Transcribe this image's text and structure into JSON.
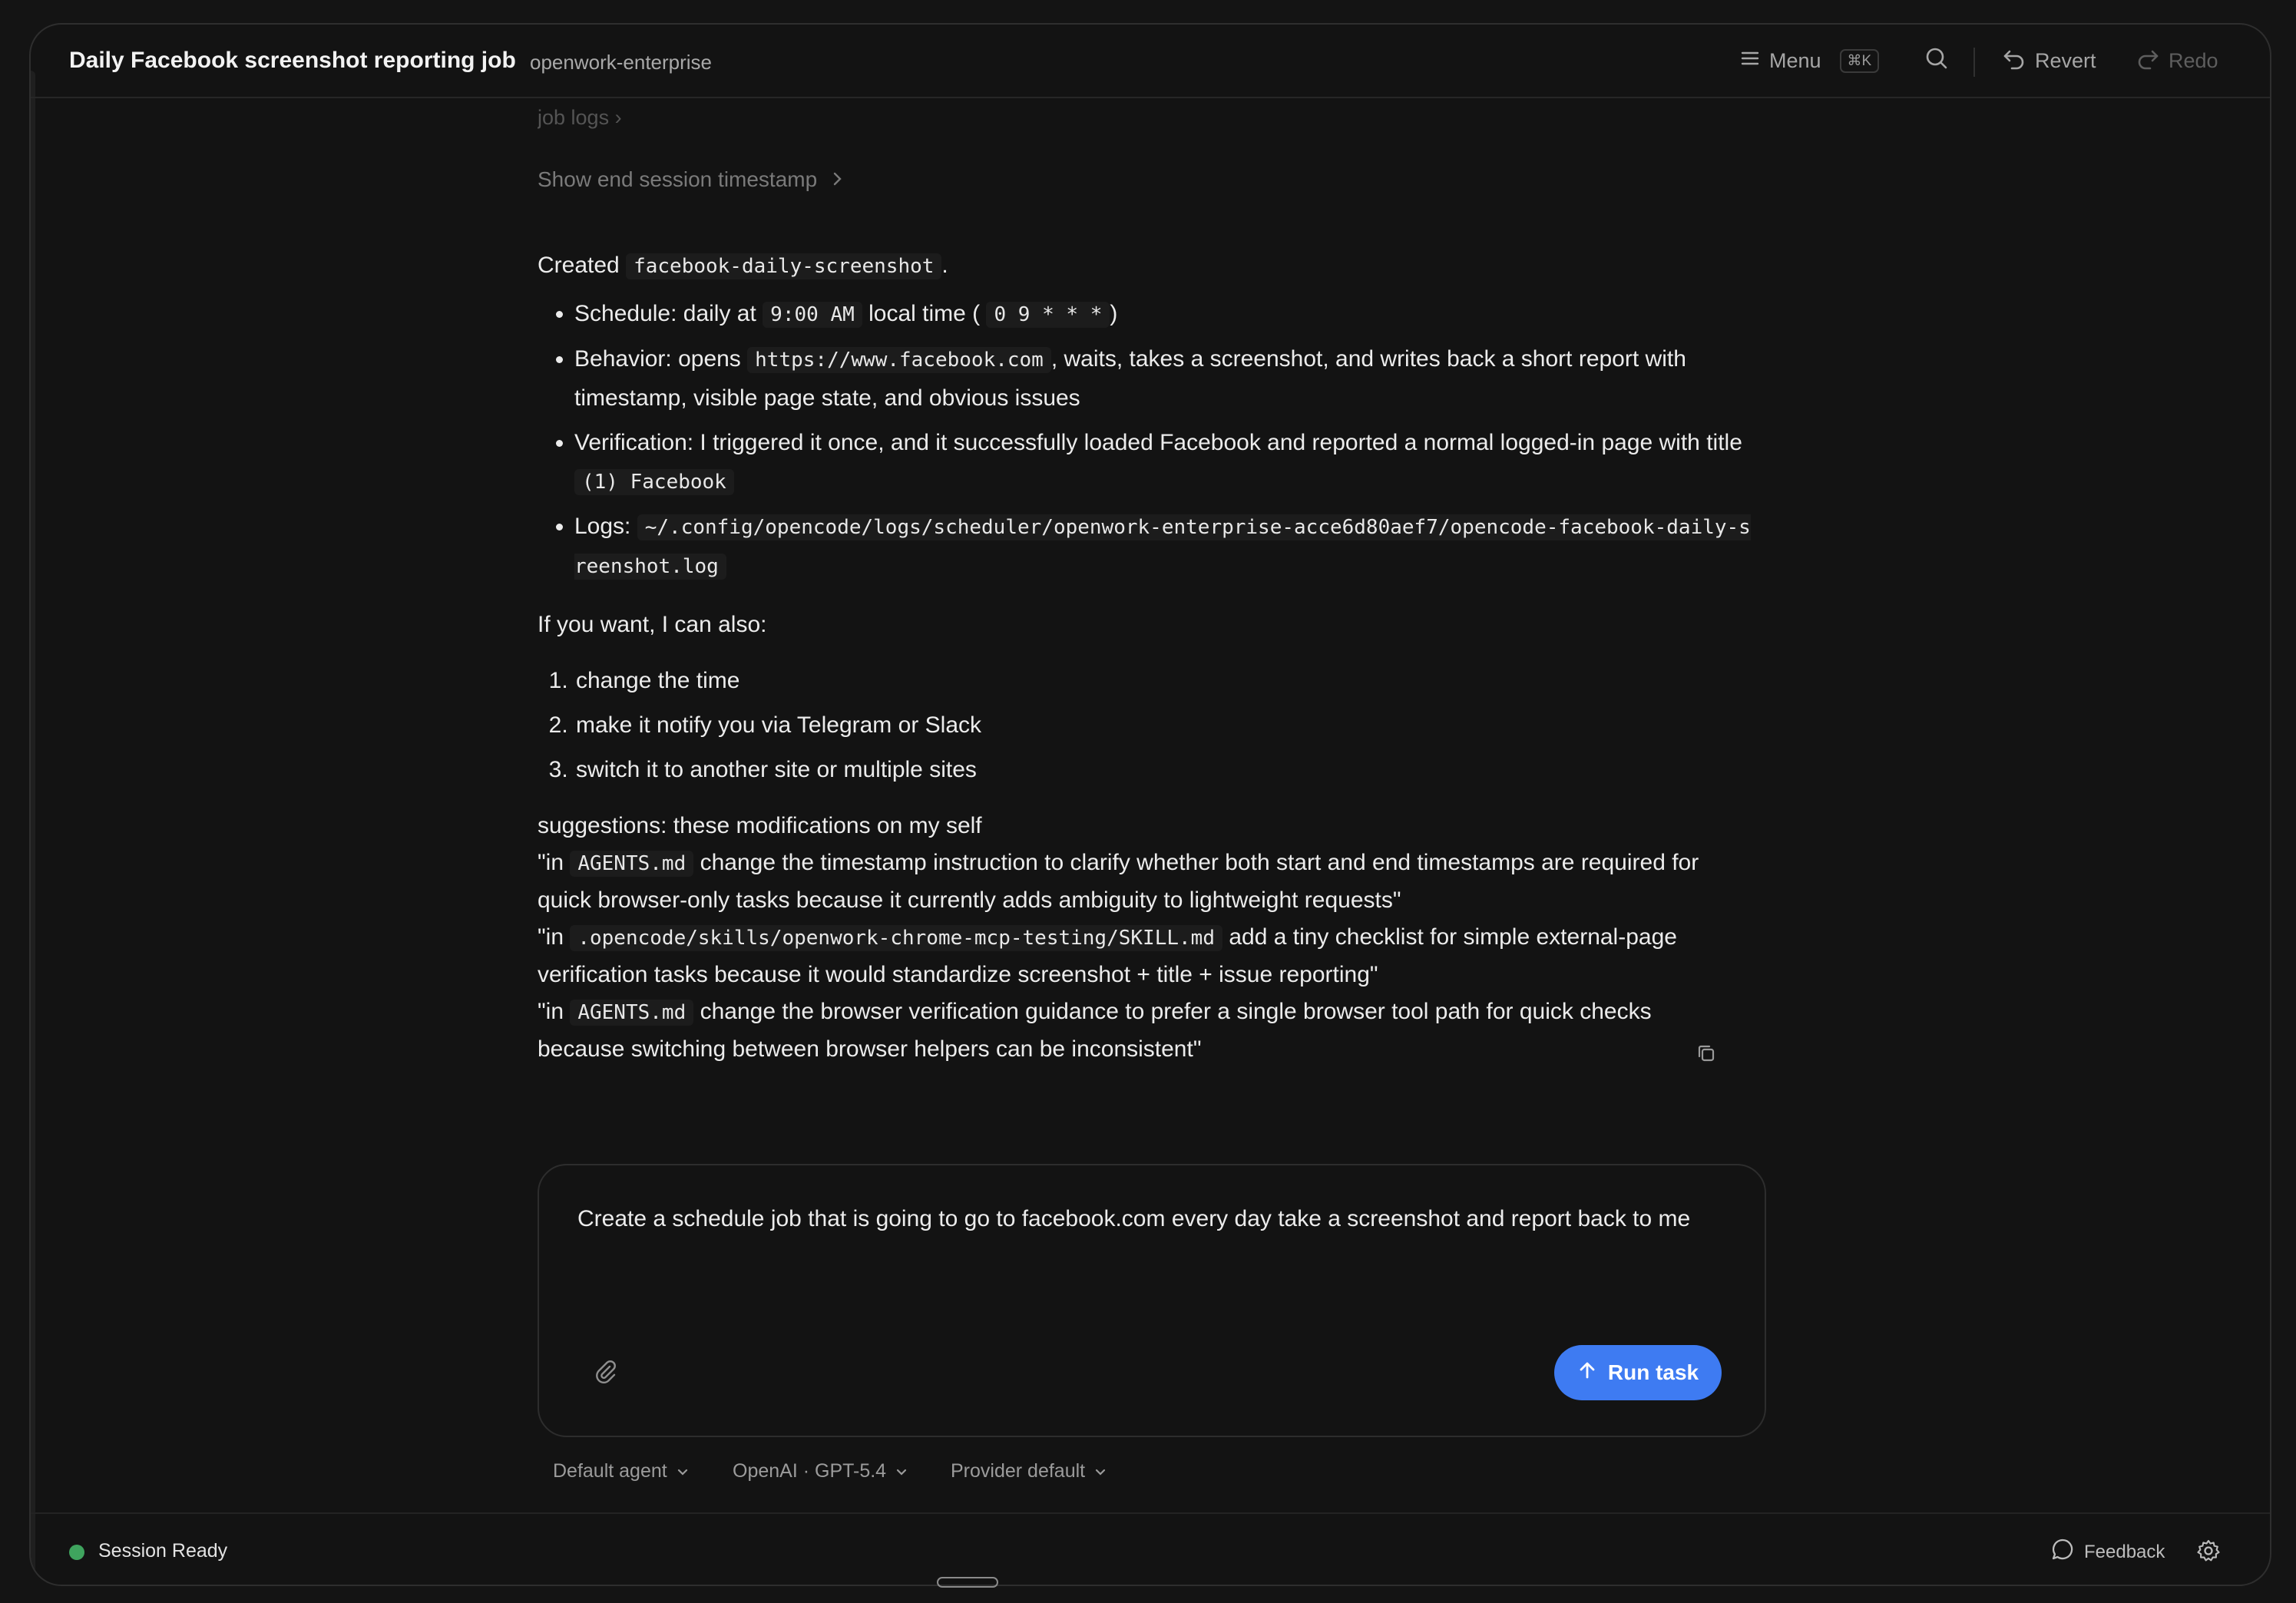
{
  "header": {
    "title": "Daily Facebook screenshot reporting job",
    "workspace": "openwork-enterprise",
    "menu_label": "Menu",
    "menu_shortcut": "⌘K",
    "revert_label": "Revert",
    "redo_label": "Redo"
  },
  "transcript": {
    "job_logs_label": "job logs",
    "show_end_session": "Show end session timestamp",
    "created_prefix": "Created",
    "created_job": "facebook-daily-screenshot",
    "created_suffix": ".",
    "bullets": {
      "schedule_label": "Schedule: daily at",
      "schedule_time": "9:00 AM",
      "schedule_mid": "local time (",
      "schedule_cron": "0 9 * * *",
      "schedule_end": ")",
      "behavior_label": "Behavior: opens",
      "behavior_url": "https://www.facebook.com",
      "behavior_rest": ", waits, takes a screenshot, and writes back a short report with timestamp, visible page state, and obvious issues",
      "verification_text": "Verification: I triggered it once, and it successfully loaded Facebook and reported a normal logged-in page with title",
      "verification_title": "(1) Facebook",
      "logs_label": "Logs:",
      "logs_path": "~/.config/opencode/logs/scheduler/openwork-enterprise-acce6d80aef7/opencode-facebook-daily-screenshot.log"
    },
    "offer": "If you want, I can also:",
    "options": [
      "change the time",
      "make it notify you via Telegram or Slack",
      "switch it to another site or multiple sites"
    ],
    "suggestions_heading": "suggestions: these modifications on my self",
    "s1_pre": "\"in",
    "s1_code": "AGENTS.md",
    "s1_post": "change the timestamp instruction to clarify whether both start and end timestamps are required for quick browser-only tasks because it currently adds ambiguity to lightweight requests\"",
    "s2_pre": "\"in",
    "s2_code": ".opencode/skills/openwork-chrome-mcp-testing/SKILL.md",
    "s2_post": "add a tiny checklist for simple external-page verification tasks because it would standardize screenshot + title + issue reporting\"",
    "s3_pre": "\"in",
    "s3_code": "AGENTS.md",
    "s3_post": "change the browser verification guidance to prefer a single browser tool path for quick checks because switching between browser helpers can be inconsistent\""
  },
  "composer": {
    "value": "Create a schedule job that is going to go to facebook.com every day take a screenshot and report back to me",
    "run_label": "Run task"
  },
  "selectors": {
    "agent": "Default agent",
    "model": "OpenAI · GPT-5.4",
    "provider": "Provider default"
  },
  "footer": {
    "status": "Session Ready",
    "feedback": "Feedback"
  },
  "colors": {
    "accent": "#3e7bf2",
    "status_ready": "#3fa45e",
    "background": "#131313"
  }
}
